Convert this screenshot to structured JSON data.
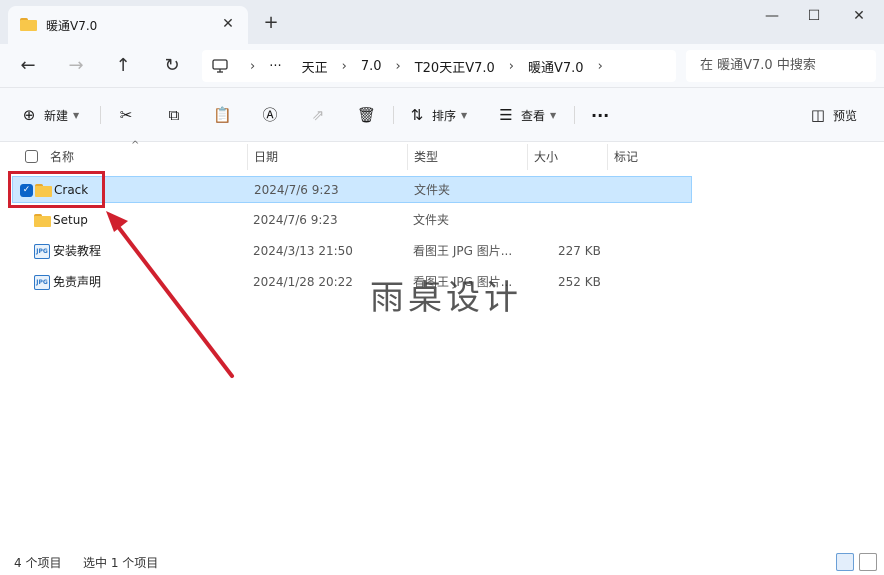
{
  "window": {
    "tab_title": "暖通V7.0",
    "tab_close": "✕",
    "new_tab": "+",
    "minimize": "—",
    "maximize": "☐",
    "close": "✕"
  },
  "nav": {
    "back": "←",
    "forward": "→",
    "up": "↑",
    "refresh": "↻",
    "computer_icon": "monitor-icon",
    "ellipsis": "···",
    "breadcrumbs": [
      "天正",
      "7.0",
      "T20天正V7.0",
      "暖通V7.0"
    ],
    "search_placeholder": "在 暖通V7.0 中搜索"
  },
  "toolbar": {
    "new_label": "新建",
    "sort_label": "排序",
    "view_label": "查看",
    "more_label": "···",
    "preview_label": "预览"
  },
  "columns": {
    "name": "名称",
    "date": "日期",
    "type": "类型",
    "size": "大小",
    "tags": "标记"
  },
  "files": [
    {
      "name": "Crack",
      "date": "2024/7/6 9:23",
      "type": "文件夹",
      "size": "",
      "icon": "folder-icon",
      "selected": true
    },
    {
      "name": "Setup",
      "date": "2024/7/6 9:23",
      "type": "文件夹",
      "size": "",
      "icon": "folder-icon",
      "selected": false
    },
    {
      "name": "安装教程",
      "date": "2024/3/13 21:50",
      "type": "看图王 JPG 图片...",
      "size": "227 KB",
      "icon": "jpg-file-icon",
      "selected": false
    },
    {
      "name": "免责声明",
      "date": "2024/1/28 20:22",
      "type": "看图王 JPG 图片...",
      "size": "252 KB",
      "icon": "jpg-file-icon",
      "selected": false
    }
  ],
  "jpg_badge": "JPG",
  "watermark": "雨桌设计",
  "status": {
    "item_count": "4 个项目",
    "selected_count": "选中 1 个项目"
  },
  "colors": {
    "highlight": "#d0202e",
    "selection": "#cce8ff",
    "accent": "#0a64c8"
  }
}
